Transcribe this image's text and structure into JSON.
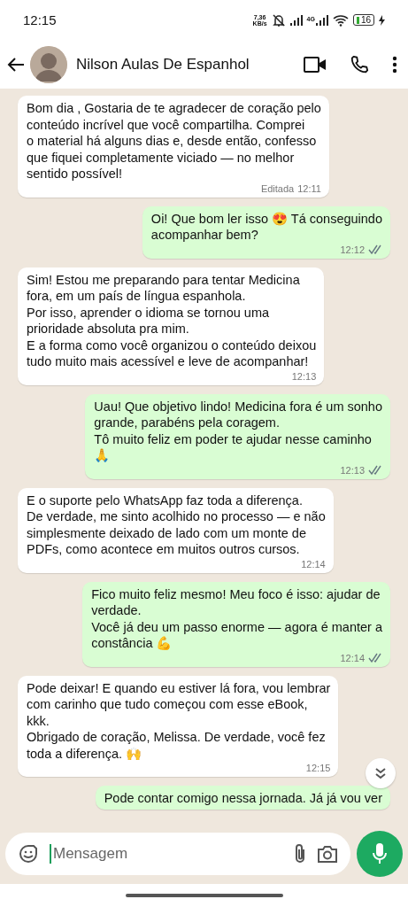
{
  "status_bar": {
    "time": "12:15",
    "speed_value": "7,36",
    "speed_unit": "KB/s",
    "network": "4G",
    "battery": "16",
    "charging": true
  },
  "header": {
    "contact_name": "Nilson Aulas De Espanhol"
  },
  "messages": [
    {
      "kind": "incoming",
      "text": "Bom dia , Gostaria de te agradecer de coração pelo\nconteúdo incrível que você compartilha. Comprei\no material há alguns dias e, desde então, confesso\nque fiquei completamente viciado — no melhor\nsentido possível!",
      "edited_label": "Editada",
      "time": "12:11"
    },
    {
      "kind": "outgoing",
      "text": "Oi! Que bom ler isso 😍 Tá conseguindo\nacompanhar bem?",
      "time": "12:12",
      "read": false
    },
    {
      "kind": "incoming",
      "text": "Sim! Estou me preparando para tentar Medicina\nfora, em um país de língua espanhola.\nPor isso, aprender o idioma se tornou uma\nprioridade absoluta pra mim.\nE a forma como você organizou o conteúdo deixou\ntudo muito mais acessível e leve de acompanhar!",
      "time": "12:13"
    },
    {
      "kind": "outgoing",
      "text": "Uau! Que objetivo lindo! Medicina fora é um sonho\ngrande, parabéns pela coragem.\nTô muito feliz em poder te ajudar nesse caminho\n🙏",
      "time": "12:13",
      "read": false
    },
    {
      "kind": "incoming",
      "text": "E o suporte pelo WhatsApp faz toda a diferença.\nDe verdade, me sinto acolhido no processo — e não\nsimplesmente deixado de lado com um monte de\nPDFs, como acontece em muitos outros cursos.",
      "time": "12:14"
    },
    {
      "kind": "outgoing",
      "text": "Fico muito feliz mesmo! Meu foco é isso: ajudar de\nverdade.\nVocê já deu um passo enorme — agora é manter a\nconstância 💪",
      "time": "12:14",
      "read": false
    },
    {
      "kind": "incoming",
      "text": "Pode deixar! E quando eu estiver lá fora, vou lembrar\ncom carinho que tudo começou com esse eBook,\nkkk.\nObrigado de coração, Melissa. De verdade, você fez\ntoda a diferença. 🙌",
      "time": "12:15"
    },
    {
      "kind": "outgoing",
      "text": "Pode contar comigo nessa jornada. Já já vou ver"
    }
  ],
  "composer": {
    "placeholder": "Mensagem"
  }
}
